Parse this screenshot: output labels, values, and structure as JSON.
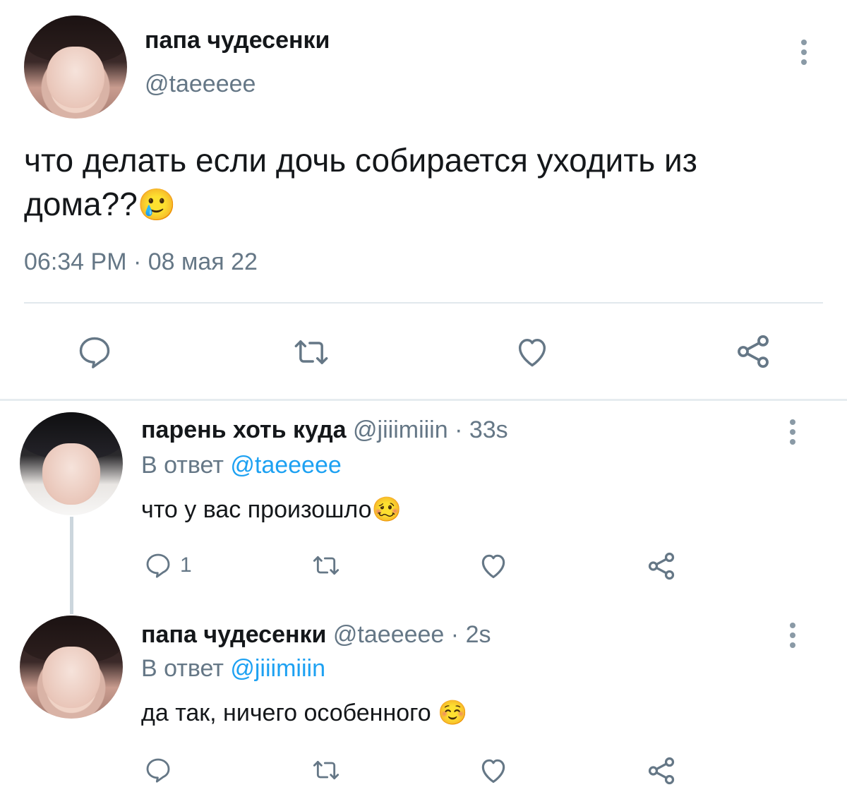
{
  "main_tweet": {
    "display_name": "папа чудесенки",
    "handle": "@taeeeee",
    "text_line1": "что делать если дочь собирается уходить из",
    "text_line2": "дома??",
    "emoji": "🥲",
    "timestamp": "06:34 PM · 08 мая 22"
  },
  "replies": [
    {
      "display_name": "парень хоть куда",
      "handle": "@jiiimiiin",
      "age": "· 33s",
      "reply_prefix": "В ответ",
      "reply_to": "@taeeeee",
      "text": "что у вас произошло",
      "emoji": "🥴",
      "reply_count": "1"
    },
    {
      "display_name": "папа чудесенки",
      "handle": "@taeeeee",
      "age": "· 2s",
      "reply_prefix": "В ответ",
      "reply_to": "@jiiimiiin",
      "text": "да так, ничего особенного",
      "emoji": "☺️",
      "reply_count": ""
    }
  ],
  "icons": [
    "reply-icon",
    "retweet-icon",
    "like-icon",
    "share-icon",
    "more-options-icon"
  ],
  "colors": {
    "text": "#14171a",
    "muted": "#657786",
    "link": "#1da1f2",
    "icon": "#657786"
  }
}
